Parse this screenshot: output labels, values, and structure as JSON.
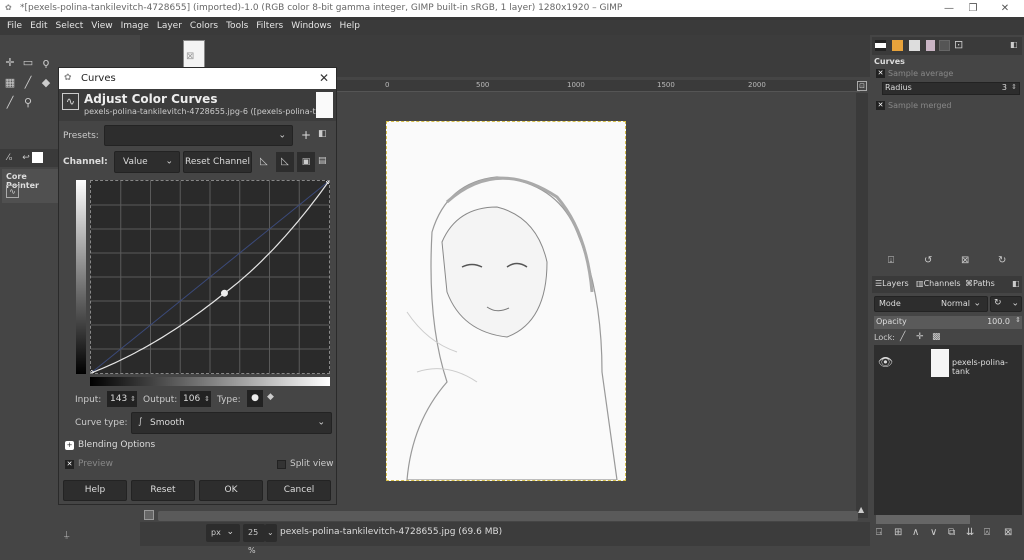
{
  "window": {
    "title": "*[pexels-polina-tankilevitch-4728655] (imported)-1.0 (RGB color 8-bit gamma integer, GIMP built-in sRGB, 1 layer) 1280x1920 – GIMP",
    "controls": [
      "—",
      "❐",
      "✕"
    ]
  },
  "menu": [
    "File",
    "Edit",
    "Select",
    "View",
    "Image",
    "Layer",
    "Colors",
    "Tools",
    "Filters",
    "Windows",
    "Help"
  ],
  "toolbox": {
    "tool_options_title": "Core Pointer"
  },
  "ruler": {
    "labels": [
      "0",
      "500",
      "1000",
      "1500",
      "2000"
    ]
  },
  "curves_dialog": {
    "window_title": "Curves",
    "heading": "Adjust Color Curves",
    "subheading": "pexels-polina-tankilevitch-4728655.jpg-6 ([pexels-polina-t...",
    "presets_label": "Presets:",
    "presets_value": "",
    "channel_label": "Channel:",
    "channel_value": "Value",
    "reset_channel": "Reset Channel",
    "input_label": "Input:",
    "input_value": "143",
    "output_label": "Output:",
    "output_value": "106",
    "type_label": "Type:",
    "curve_type_label": "Curve type:",
    "curve_type_value": "Smooth",
    "blending_options": "Blending Options",
    "preview_label": "Preview",
    "preview_checked": true,
    "split_view_label": "Split view",
    "split_view_checked": false,
    "buttons": {
      "help": "Help",
      "reset": "Reset",
      "ok": "OK",
      "cancel": "Cancel"
    },
    "curve_point": {
      "input": 143,
      "output": 106
    }
  },
  "status": {
    "unit": "px",
    "zoom": "25 %",
    "file_info": "pexels-polina-tankilevitch-4728655.jpg (69.6 MB)"
  },
  "right_panel": {
    "tool_options_title": "Curves",
    "sample_average": "Sample average",
    "radius_label": "Radius",
    "radius_value": "3",
    "sample_merged": "Sample merged",
    "tabs": [
      "Layers",
      "Channels",
      "Paths"
    ],
    "mode_label": "Mode",
    "mode_value": "Normal",
    "opacity_label": "Opacity",
    "opacity_value": "100.0",
    "lock_label": "Lock:",
    "layer_name": "pexels-polina-tank"
  }
}
